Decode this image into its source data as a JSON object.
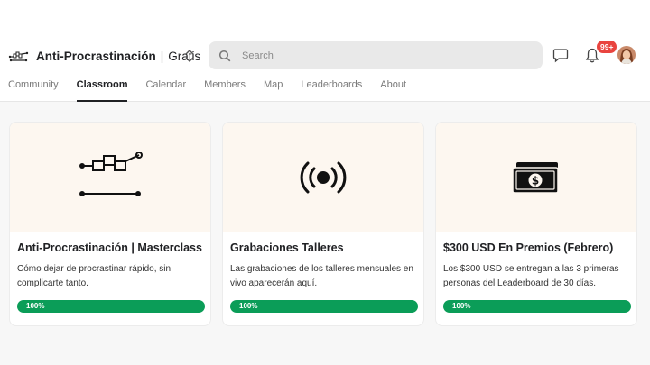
{
  "header": {
    "group_name": "Anti-Procrastinación",
    "separator": "|",
    "plan": "Gratis",
    "logo_text": "-stbr-",
    "search_placeholder": "Search",
    "notifications_badge": "99+"
  },
  "icons": {
    "logo": "circuit-logo-icon",
    "switch": "chevron-up-down-icon",
    "search": "search-icon",
    "chat": "chat-icon",
    "bell": "bell-icon"
  },
  "tabs": [
    {
      "label": "Community",
      "active": false
    },
    {
      "label": "Classroom",
      "active": true
    },
    {
      "label": "Calendar",
      "active": false
    },
    {
      "label": "Members",
      "active": false
    },
    {
      "label": "Map",
      "active": false
    },
    {
      "label": "Leaderboards",
      "active": false
    },
    {
      "label": "About",
      "active": false
    }
  ],
  "courses": [
    {
      "title": "Anti-Procrastinación | Masterclass",
      "description": "Cómo dejar de procrastinar rápido, sin complicarte tanto.",
      "progress_label": "100%",
      "progress": 1.0,
      "icon": "circuit-icon"
    },
    {
      "title": "Grabaciones Talleres",
      "description": "Las grabaciones de los talleres mensuales en vivo aparecerán aquí.",
      "progress_label": "100%",
      "progress": 1.0,
      "icon": "broadcast-icon"
    },
    {
      "title": "$300 USD En Premios (Febrero)",
      "description": "Los $300 USD se entregan a las 3 primeras personas del Leaderboard de 30 días.",
      "progress_label": "100%",
      "progress": 1.0,
      "icon": "money-icon"
    }
  ],
  "colors": {
    "progress": "#0b9d58",
    "badge": "#e9443f",
    "cover": "#fdf7f0",
    "background": "#f7f7f7"
  }
}
